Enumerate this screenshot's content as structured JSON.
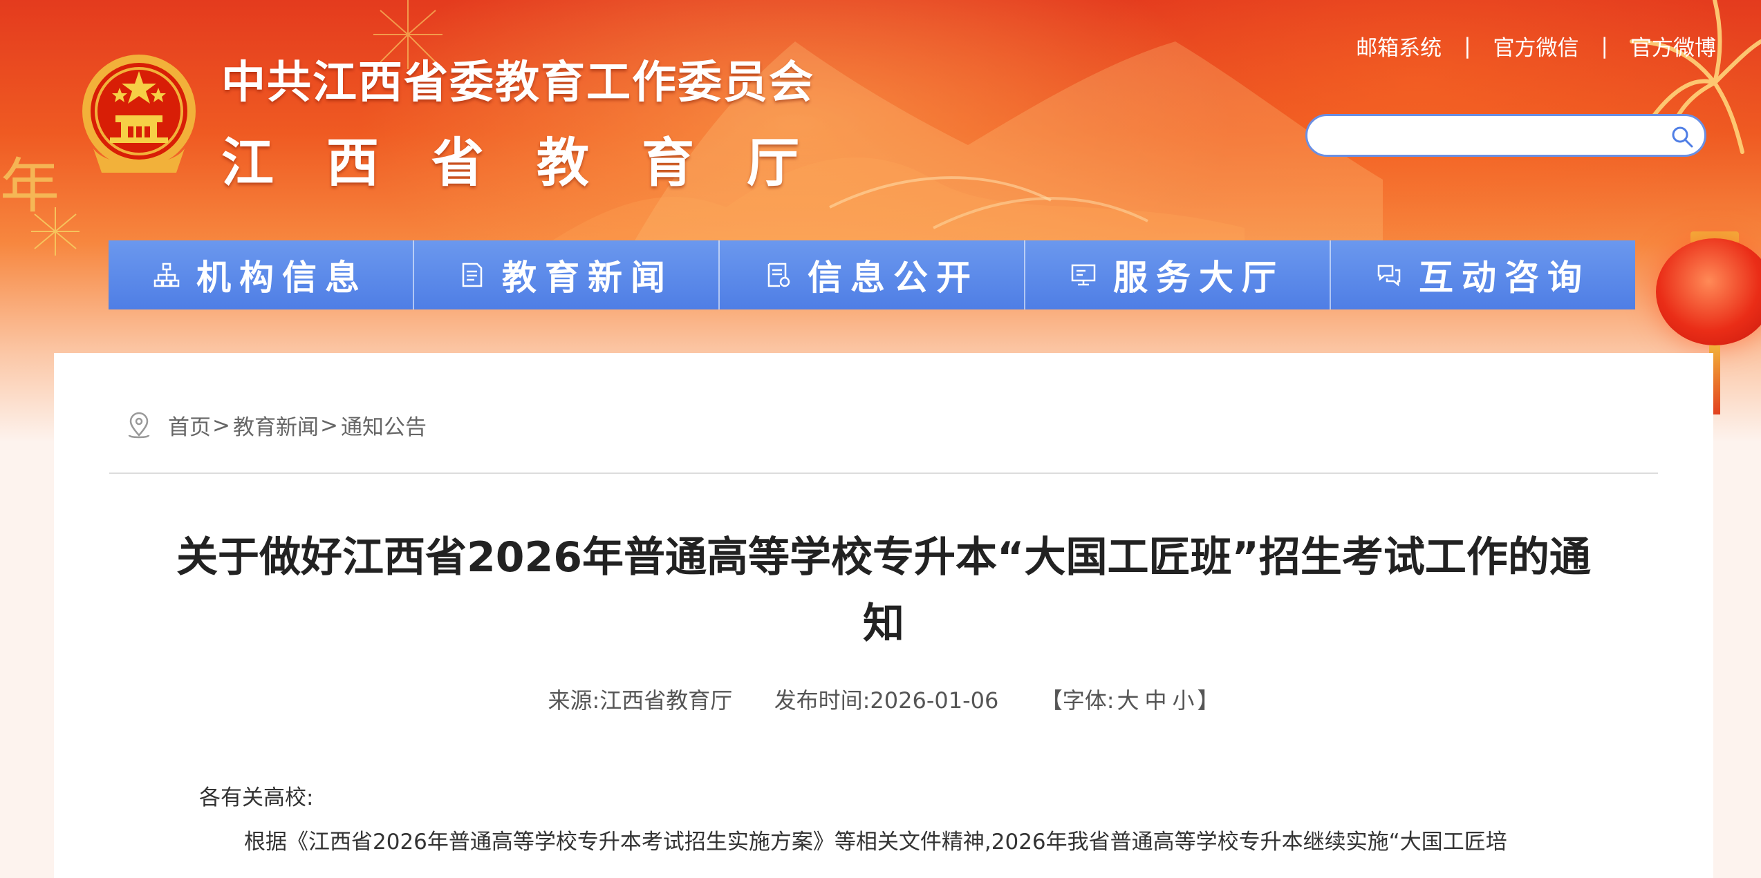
{
  "header": {
    "org_line1": "中共江西省委教育工作委员会",
    "org_line2": "江西省教育厅",
    "links": [
      "邮箱系统",
      "官方微信",
      "官方微博"
    ],
    "left_decoration": "年"
  },
  "search": {
    "value": "",
    "placeholder": ""
  },
  "nav": [
    {
      "label": "机构信息",
      "icon": "org-chart-icon"
    },
    {
      "label": "教育新闻",
      "icon": "document-icon"
    },
    {
      "label": "信息公开",
      "icon": "file-list-icon"
    },
    {
      "label": "服务大厅",
      "icon": "monitor-icon"
    },
    {
      "label": "互动咨询",
      "icon": "chat-bubbles-icon"
    }
  ],
  "breadcrumb": {
    "items": [
      "首页",
      "教育新闻",
      "通知公告"
    ],
    "separator": ">"
  },
  "article": {
    "title": "关于做好江西省2026年普通高等学校专升本“大国工匠班”招生考试工作的通知",
    "source_label": "来源:",
    "source": "江西省教育厅",
    "date_label": "发布时间:",
    "date": "2026-01-06",
    "font_prefix": "【字体:",
    "font_sizes": [
      "大",
      "中",
      "小"
    ],
    "font_suffix": "】",
    "salutation": "各有关高校:",
    "paragraph": "根据《江西省2026年普通高等学校专升本考试招生实施方案》等相关文件精神,2026年我省普通高等学校专升本继续实施“大国工匠培"
  },
  "colors": {
    "nav_blue": "#5585e8",
    "banner_red": "#e43b1e",
    "banner_orange": "#f7873f",
    "title_text": "#222222"
  }
}
